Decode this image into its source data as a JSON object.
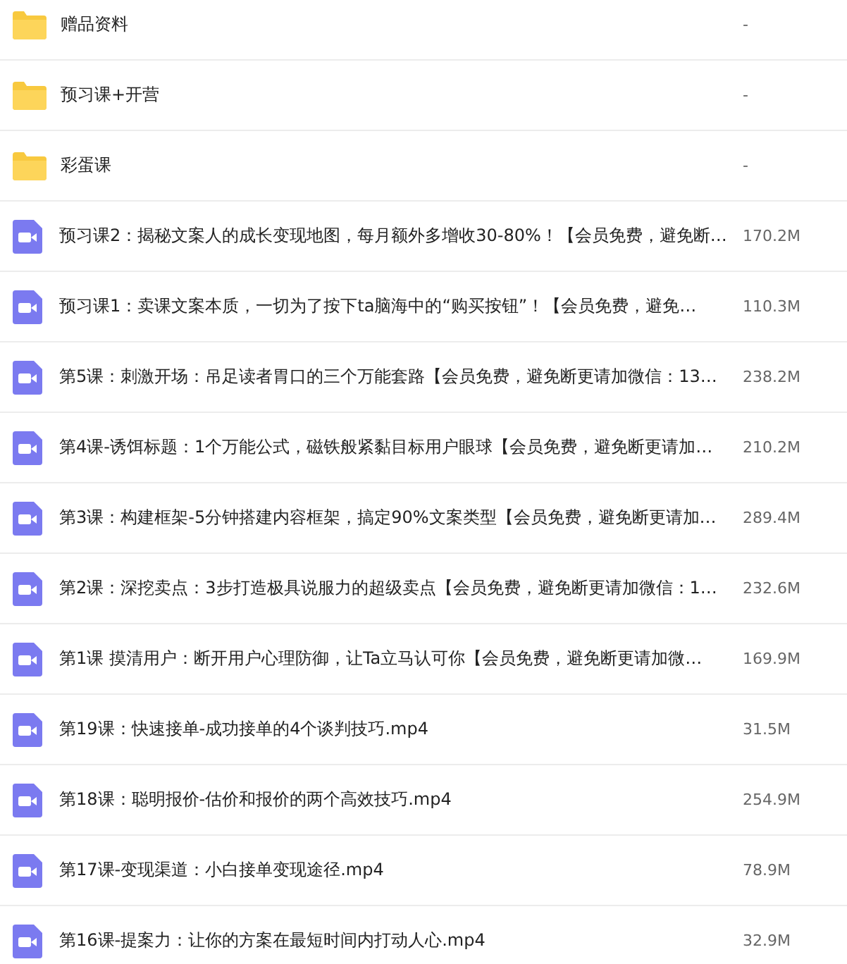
{
  "files": [
    {
      "kind": "folder",
      "name": "赠品资料",
      "size": "-"
    },
    {
      "kind": "folder",
      "name": "预习课+开营",
      "size": "-"
    },
    {
      "kind": "folder",
      "name": "彩蛋课",
      "size": "-"
    },
    {
      "kind": "video",
      "name": "预习课2：揭秘文案人的成长变现地图，每月额外多增收30-80%！【会员免费，避免断…",
      "size": "170.2M"
    },
    {
      "kind": "video",
      "name": "预习课1：卖课文案本质，一切为了按下ta脑海中的“购买按钮”！【会员免费，避免…",
      "size": "110.3M"
    },
    {
      "kind": "video",
      "name": "第5课：刺激开场：吊足读者胃口的三个万能套路【会员免费，避免断更请加微信：13…",
      "size": "238.2M"
    },
    {
      "kind": "video",
      "name": "第4课-诱饵标题：1个万能公式，磁铁般紧黏目标用户眼球【会员免费，避免断更请加…",
      "size": "210.2M"
    },
    {
      "kind": "video",
      "name": "第3课：构建框架-5分钟搭建内容框架，搞定90%文案类型【会员免费，避免断更请加…",
      "size": "289.4M"
    },
    {
      "kind": "video",
      "name": "第2课：深挖卖点：3步打造极具说服力的超级卖点【会员免费，避免断更请加微信：1…",
      "size": "232.6M"
    },
    {
      "kind": "video",
      "name": "第1课 摸清用户：断开用户心理防御，让Ta立马认可你【会员免费，避免断更请加微…",
      "size": "169.9M"
    },
    {
      "kind": "video",
      "name": "第19课：快速接单-成功接单的4个谈判技巧.mp4",
      "size": "31.5M"
    },
    {
      "kind": "video",
      "name": "第18课：聪明报价-估价和报价的两个高效技巧.mp4",
      "size": "254.9M"
    },
    {
      "kind": "video",
      "name": "第17课-变现渠道：小白接单变现途径.mp4",
      "size": "78.9M"
    },
    {
      "kind": "video",
      "name": "第16课-提案力：让你的方案在最短时间内打动人心.mp4",
      "size": "32.9M"
    }
  ]
}
